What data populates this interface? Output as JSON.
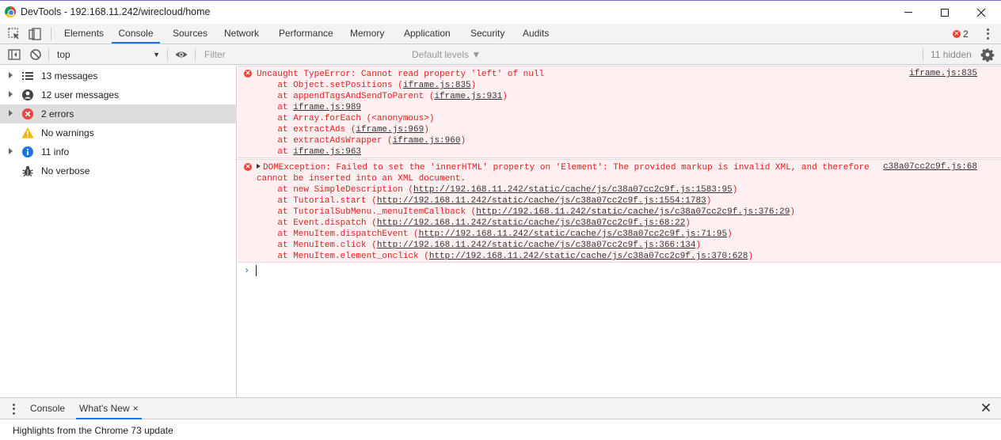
{
  "window": {
    "title": "DevTools - 192.168.11.242/wirecloud/home"
  },
  "tabs": [
    {
      "label": "Elements"
    },
    {
      "label": "Console"
    },
    {
      "label": "Sources"
    },
    {
      "label": "Network"
    },
    {
      "label": "Performance"
    },
    {
      "label": "Memory"
    },
    {
      "label": "Application"
    },
    {
      "label": "Security"
    },
    {
      "label": "Audits"
    }
  ],
  "active_tab": "Console",
  "error_badge": "2",
  "console_toolbar": {
    "context": "top",
    "filter_placeholder": "Filter",
    "levels": "Default levels ▼",
    "hidden": "11 hidden"
  },
  "sidebar": {
    "items": [
      {
        "label": "13 messages",
        "icon": "list-icon"
      },
      {
        "label": "12 user messages",
        "icon": "user-icon"
      },
      {
        "label": "2 errors",
        "icon": "error-icon",
        "selected": true
      },
      {
        "label": "No warnings",
        "icon": "warning-icon"
      },
      {
        "label": "11 info",
        "icon": "info-icon"
      },
      {
        "label": "No verbose",
        "icon": "bug-icon"
      }
    ]
  },
  "messages": [
    {
      "source": "iframe.js:835",
      "lines": [
        {
          "text": "Uncaught TypeError: Cannot read property 'left' of null"
        },
        {
          "pre": "    at Object.setPositions (",
          "link": "iframe.js:835",
          "post": ")"
        },
        {
          "pre": "    at appendTagsAndSendToParent (",
          "link": "iframe.js:931",
          "post": ")"
        },
        {
          "pre": "    at ",
          "link": "iframe.js:989",
          "post": ""
        },
        {
          "pre": "    at Array.forEach (<anonymous>)",
          "link": "",
          "post": ""
        },
        {
          "pre": "    at extractAds (",
          "link": "iframe.js:969",
          "post": ")"
        },
        {
          "pre": "    at extractAdsWrapper (",
          "link": "iframe.js:960",
          "post": ")"
        },
        {
          "pre": "    at ",
          "link": "iframe.js:963",
          "post": ""
        }
      ]
    },
    {
      "source": "c38a07cc2c9f.js:68",
      "lines": [
        {
          "text": "DOMException: Failed to set the 'innerHTML' property on 'Element': The provided markup is invalid XML, and therefore"
        },
        {
          "text": "cannot be inserted into an XML document."
        },
        {
          "pre": "    at new SimpleDescription (",
          "link": "http://192.168.11.242/static/cache/js/c38a07cc2c9f.js:1583:95",
          "post": ")"
        },
        {
          "pre": "    at Tutorial.start (",
          "link": "http://192.168.11.242/static/cache/js/c38a07cc2c9f.js:1554:1783",
          "post": ")"
        },
        {
          "pre": "    at TutorialSubMenu._menuItemCallback (",
          "link": "http://192.168.11.242/static/cache/js/c38a07cc2c9f.js:376:29",
          "post": ")"
        },
        {
          "pre": "    at Event.dispatch (",
          "link": "http://192.168.11.242/static/cache/js/c38a07cc2c9f.js:68:22",
          "post": ")"
        },
        {
          "pre": "    at MenuItem.dispatchEvent (",
          "link": "http://192.168.11.242/static/cache/js/c38a07cc2c9f.js:71:95",
          "post": ")"
        },
        {
          "pre": "    at MenuItem.click (",
          "link": "http://192.168.11.242/static/cache/js/c38a07cc2c9f.js:366:134",
          "post": ")"
        },
        {
          "pre": "    at MenuItem.element_onclick (",
          "link": "http://192.168.11.242/static/cache/js/c38a07cc2c9f.js:370:628",
          "post": ")"
        }
      ]
    }
  ],
  "prompt": "›",
  "drawer": {
    "tabs": [
      {
        "label": "Console"
      },
      {
        "label": "What's New"
      }
    ],
    "close_glyph": "×",
    "body": "Highlights from the Chrome 73 update"
  },
  "colors": {
    "error": "#e02020",
    "error_bg": "#fef0f0",
    "accent": "#1a73e8"
  }
}
